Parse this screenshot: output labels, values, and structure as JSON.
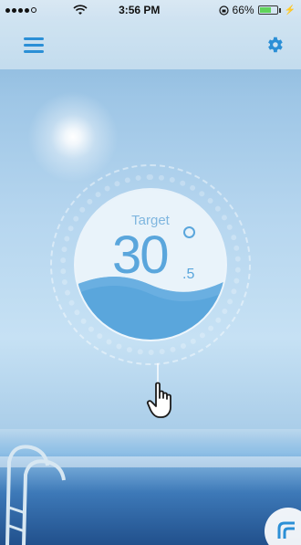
{
  "status_bar": {
    "time": "3:56 PM",
    "battery_percent": "66%",
    "battery_level": 0.66,
    "signal_bars": 4
  },
  "header": {
    "menu_icon": "hamburger-menu-icon",
    "settings_icon": "gear-icon"
  },
  "thermostat": {
    "label": "Target",
    "temperature_integer": "30",
    "temperature_decimal": ".5",
    "degree_symbol": "°"
  },
  "colors": {
    "accent": "#2b8fd6",
    "water": "#5aa6dc",
    "battery": "#5fd35a"
  },
  "icons": {
    "pointer": "hand-pointer-icon",
    "corner": "quick-action-icon"
  }
}
